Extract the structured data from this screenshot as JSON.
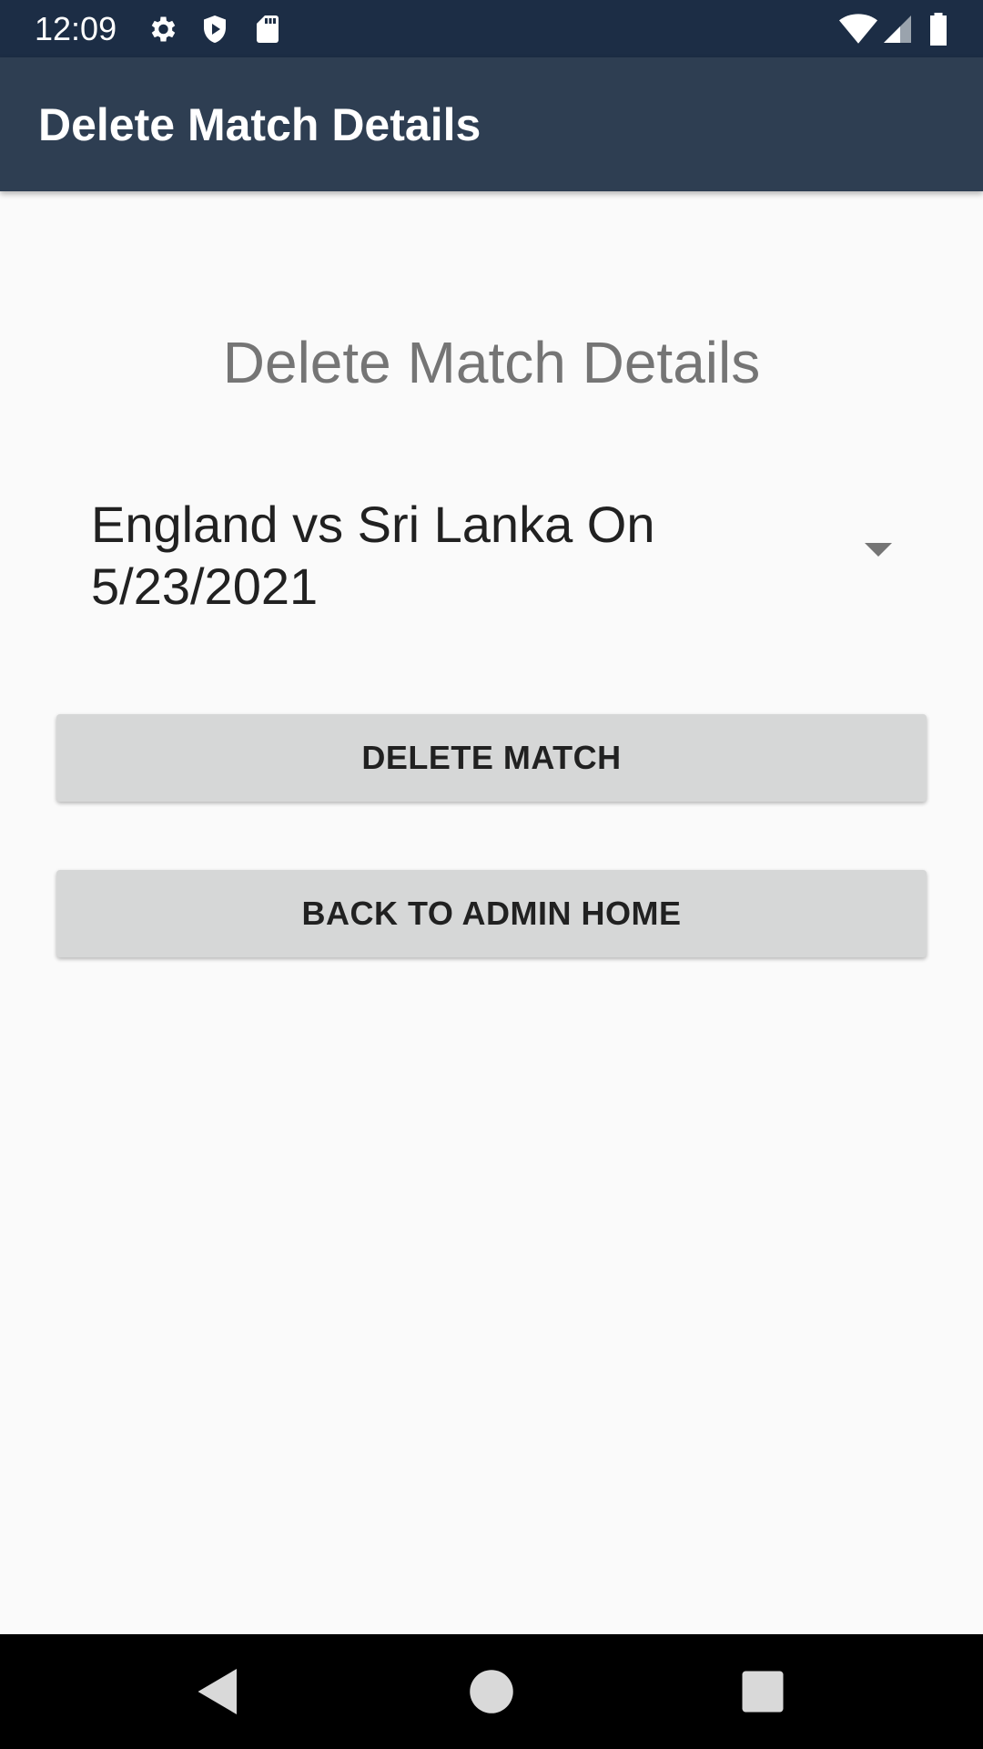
{
  "status_bar": {
    "time": "12:09",
    "icons_left": [
      "gear-icon",
      "shield-icon",
      "sd-card-icon"
    ],
    "icons_right": [
      "wifi-icon",
      "cell-signal-icon",
      "battery-icon"
    ]
  },
  "app_bar": {
    "title": "Delete Match Details"
  },
  "main": {
    "heading": "Delete Match Details",
    "match_spinner": {
      "selected_value": "England vs Sri Lanka On 5/23/2021"
    },
    "delete_button_label": "DELETE MATCH",
    "back_button_label": "BACK TO ADMIN HOME"
  },
  "nav_bar": {
    "icons": [
      "back-icon",
      "home-icon",
      "recents-icon"
    ]
  },
  "colors": {
    "status_bar": "#1c2d45",
    "app_bar": "#2e3e52",
    "background": "#fafafa",
    "button": "#d6d7d7",
    "heading_text": "#757575"
  }
}
